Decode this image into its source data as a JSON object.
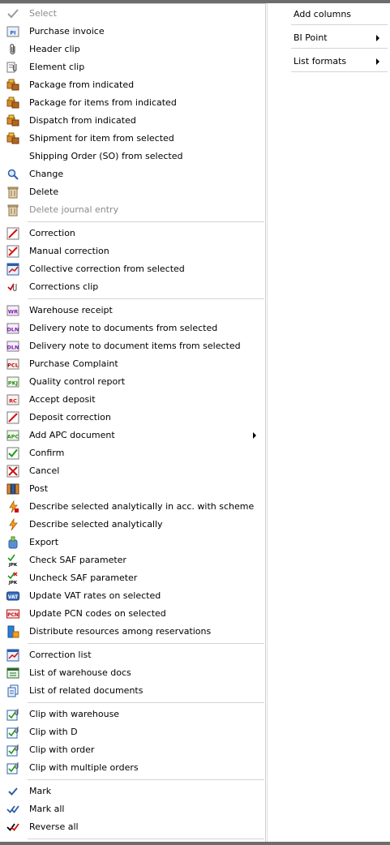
{
  "left_menu": {
    "items": [
      {
        "label": "Select",
        "icon": "check-icon",
        "disabled": true
      },
      {
        "label": "Purchase invoice",
        "icon": "pi-document-icon"
      },
      {
        "label": "Header clip",
        "icon": "paperclip-icon"
      },
      {
        "label": "Element clip",
        "icon": "element-clip-icon"
      },
      {
        "label": "Package from indicated",
        "icon": "package-icon"
      },
      {
        "label": "Package for items from indicated",
        "icon": "package-icon"
      },
      {
        "label": "Dispatch from indicated",
        "icon": "package-icon"
      },
      {
        "label": "Shipment for item from selected",
        "icon": "package-icon"
      },
      {
        "label": "Shipping Order (SO) from selected",
        "icon": ""
      },
      {
        "label": "Change",
        "icon": "magnifier-icon"
      },
      {
        "label": "Delete",
        "icon": "trash-icon"
      },
      {
        "label": "Delete journal entry",
        "icon": "trash-icon",
        "disabled": true
      },
      {
        "label": "Correction",
        "icon": "correction-icon"
      },
      {
        "label": "Manual correction",
        "icon": "manual-correction-icon"
      },
      {
        "label": "Collective correction from selected",
        "icon": "collective-correction-icon"
      },
      {
        "label": "Corrections clip",
        "icon": "corrections-clip-icon"
      },
      {
        "label": "Warehouse receipt",
        "icon": "wr-icon"
      },
      {
        "label": "Delivery note to documents from selected",
        "icon": "dln-icon"
      },
      {
        "label": "Delivery note to document items from selected",
        "icon": "dln-icon"
      },
      {
        "label": "Purchase Complaint",
        "icon": "pcl-icon"
      },
      {
        "label": "Quality control report",
        "icon": "pkj-icon"
      },
      {
        "label": "Accept deposit",
        "icon": "rc-icon"
      },
      {
        "label": "Deposit correction",
        "icon": "correction-icon"
      },
      {
        "label": "Add APC document",
        "icon": "apc-icon",
        "submenu": true
      },
      {
        "label": "Confirm",
        "icon": "confirm-icon"
      },
      {
        "label": "Cancel",
        "icon": "cancel-icon"
      },
      {
        "label": "Post",
        "icon": "post-icon"
      },
      {
        "label": "Describe selected analytically in acc. with scheme",
        "icon": "describe-scheme-icon"
      },
      {
        "label": "Describe selected analytically",
        "icon": "lightning-icon"
      },
      {
        "label": "Export",
        "icon": "export-icon"
      },
      {
        "label": "Check SAF parameter",
        "icon": "jpk-check-icon"
      },
      {
        "label": "Uncheck SAF parameter",
        "icon": "jpk-uncheck-icon"
      },
      {
        "label": "Update VAT rates on selected",
        "icon": "vat-icon"
      },
      {
        "label": "Update PCN codes on selected",
        "icon": "pcn-icon"
      },
      {
        "label": "Distribute resources among reservations",
        "icon": "distribute-icon"
      },
      {
        "label": "Correction list",
        "icon": "correction-list-icon"
      },
      {
        "label": "List of warehouse docs",
        "icon": "warehouse-docs-icon"
      },
      {
        "label": "List of related documents",
        "icon": "related-docs-icon"
      },
      {
        "label": "Clip with warehouse",
        "icon": "clip-with-icon"
      },
      {
        "label": "Clip with D",
        "icon": "clip-with-icon"
      },
      {
        "label": "Clip with order",
        "icon": "clip-with-icon"
      },
      {
        "label": "Clip with multiple orders",
        "icon": "clip-with-icon"
      },
      {
        "label": "Mark",
        "icon": "mark-icon"
      },
      {
        "label": "Mark all",
        "icon": "mark-all-icon"
      },
      {
        "label": "Reverse all",
        "icon": "reverse-all-icon"
      }
    ],
    "separators_after": [
      11,
      15,
      34,
      37,
      41,
      44
    ]
  },
  "right_menu": {
    "items": [
      {
        "label": "Add columns",
        "submenu": false
      },
      {
        "label": "BI Point",
        "submenu": true
      },
      {
        "label": "List formats",
        "submenu": true
      }
    ]
  },
  "colors": {
    "disabled_text": "#8a8a8a",
    "separator": "#d4d4d4",
    "border": "#cfcfcf"
  }
}
